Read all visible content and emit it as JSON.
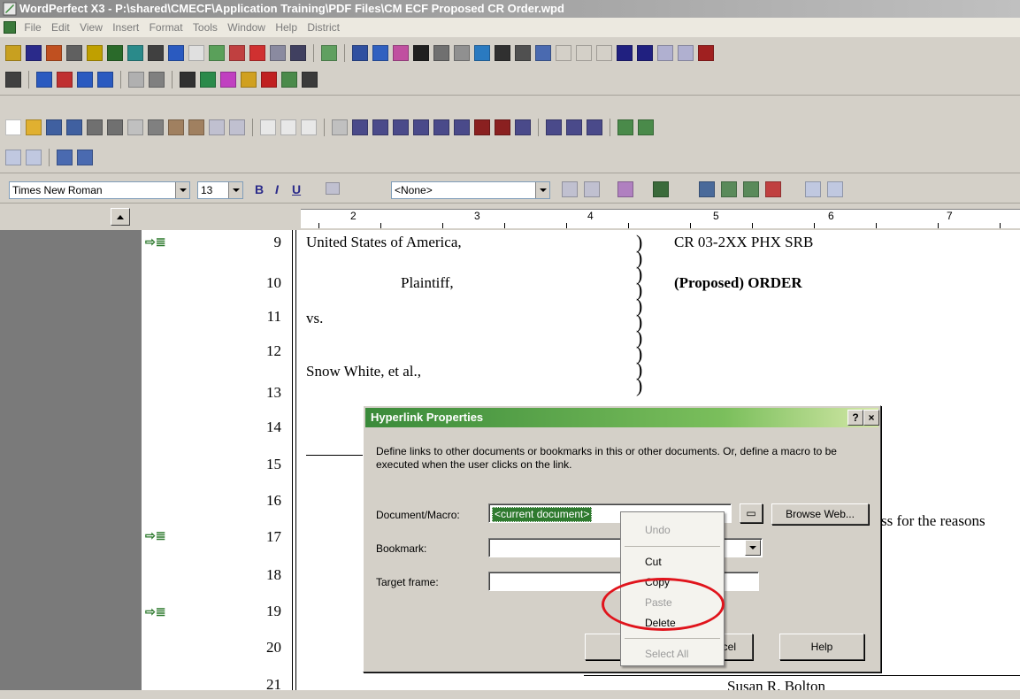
{
  "window": {
    "title": "WordPerfect X3 - P:\\shared\\CMECF\\Application Training\\PDF Files\\CM ECF Proposed CR Order.wpd"
  },
  "menu": [
    "File",
    "Edit",
    "View",
    "Insert",
    "Format",
    "Tools",
    "Window",
    "Help",
    "District"
  ],
  "property_bar": {
    "font": "Times New Roman",
    "size": "13",
    "style": "<None>",
    "bold": "B",
    "italic": "I",
    "underline": "U"
  },
  "ruler_numbers": [
    "2",
    "3",
    "4",
    "5",
    "6",
    "7"
  ],
  "line_numbers": [
    "9",
    "10",
    "11",
    "12",
    "13",
    "14",
    "15",
    "16",
    "17",
    "18",
    "19",
    "20",
    "21"
  ],
  "document": {
    "line9_left": "United States of America,",
    "line9_right": "CR 03-2XX PHX SRB",
    "plaintiff": "Plaintiff,",
    "order_title": "(Proposed) ORDER",
    "vs": "vs.",
    "defendant": "Snow White, et al.,",
    "line17_tail": "ss for the reasons",
    "judge": "Susan R. Bolton"
  },
  "dialog": {
    "title": "Hyperlink Properties",
    "help_btn": "?",
    "close_btn": "×",
    "description": "Define links to other documents or bookmarks in this or other documents. Or, define a macro to be executed when the user clicks on the link.",
    "doc_macro_label": "Document/Macro:",
    "doc_macro_value": "<current document>",
    "browse_web": "Browse Web...",
    "bookmark_label": "Bookmark:",
    "target_frame_label": "Target frame:",
    "cancel_partial": "ncel",
    "help": "Help"
  },
  "context_menu": {
    "items": [
      {
        "label": "Undo",
        "enabled": false
      },
      {
        "label": "Cut",
        "enabled": true
      },
      {
        "label": "Copy",
        "enabled": true
      },
      {
        "label": "Paste",
        "enabled": false
      },
      {
        "label": "Delete",
        "enabled": true
      },
      {
        "label": "Select All",
        "enabled": false
      }
    ]
  },
  "colors": {
    "dialog_title_start": "#3a8a3a",
    "highlight_oval": "#e0141c",
    "selection_bg": "#2f7a2f"
  }
}
